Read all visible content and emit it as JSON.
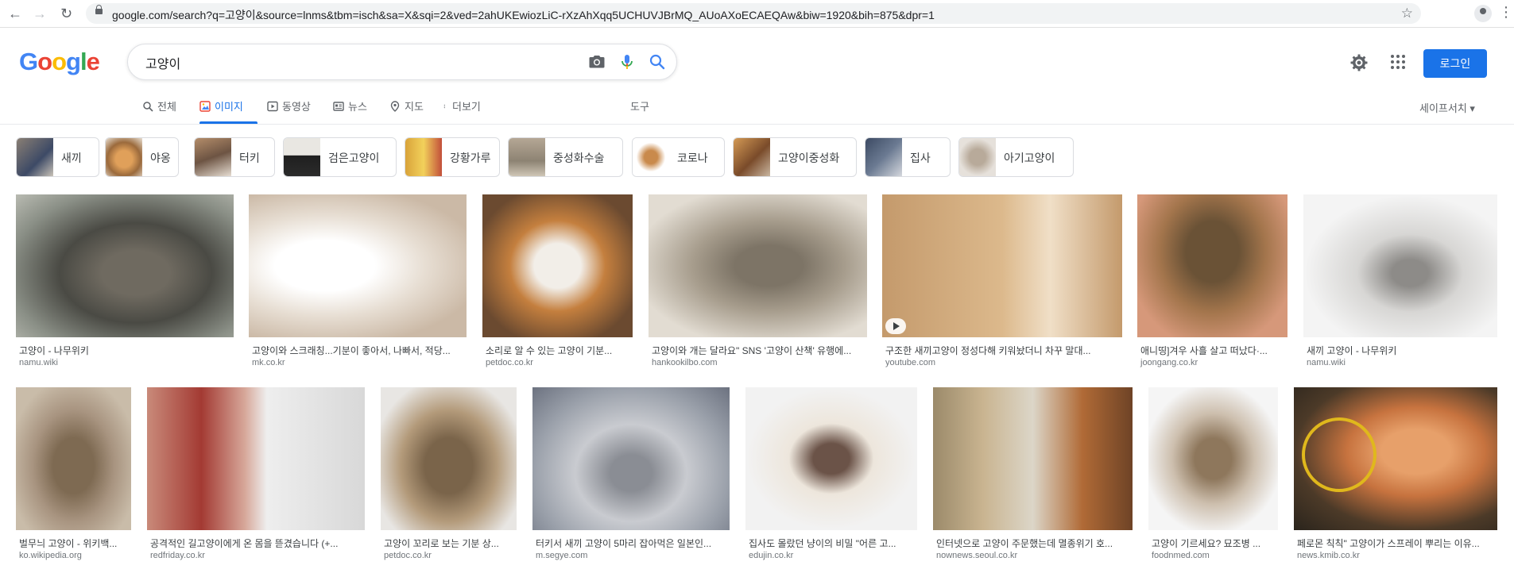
{
  "browser": {
    "back_icon": "←",
    "forward_icon": "→",
    "reload_icon": "↻",
    "url": "google.com/search?q=고양이&source=lnms&tbm=isch&sa=X&sqi=2&ved=2ahUKEwiozLiC-rXzAhXqq5UCHUVJBrMQ_AUoAXoECAEQAw&biw=1920&bih=875&dpr=1",
    "star_icon": "☆",
    "menu_icon": "⋮"
  },
  "logo": {
    "letters": [
      "G",
      "o",
      "o",
      "g",
      "l",
      "e"
    ]
  },
  "search": {
    "query": "고양이"
  },
  "header": {
    "login_label": "로그인"
  },
  "tabs": [
    {
      "label": "전체",
      "icon": "search-icon"
    },
    {
      "label": "이미지",
      "icon": "image-icon",
      "active": true
    },
    {
      "label": "동영상",
      "icon": "video-icon"
    },
    {
      "label": "뉴스",
      "icon": "news-icon"
    },
    {
      "label": "지도",
      "icon": "map-pin-icon"
    },
    {
      "label": "더보기",
      "icon": "more-icon"
    }
  ],
  "tools_label": "도구",
  "safesearch_label": "세이프서치 ▾",
  "chips": [
    {
      "label": "새끼"
    },
    {
      "label": "야옹"
    },
    {
      "label": "터키"
    },
    {
      "label": "검은고양이"
    },
    {
      "label": "강황가루"
    },
    {
      "label": "중성화수술"
    },
    {
      "label": "코로나"
    },
    {
      "label": "고양이중성화"
    },
    {
      "label": "집사"
    },
    {
      "label": "아기고양이"
    }
  ],
  "results_row1": [
    {
      "title": "고양이 - 나무위키",
      "source": "namu.wiki"
    },
    {
      "title": "고양이와 스크래칭...기분이 좋아서, 나빠서, 적당...",
      "source": "mk.co.kr"
    },
    {
      "title": "소리로 알 수 있는 고양이 기분...",
      "source": "petdoc.co.kr"
    },
    {
      "title": "고양이와 개는 달라요\" SNS '고양이 산책' 유행에...",
      "source": "hankookilbo.com"
    },
    {
      "title": "구조한 새끼고양이 정성다해 키워놨더니 차꾸 말대...",
      "source": "youtube.com"
    },
    {
      "title": "애니띵]겨우 사흘 살고 떠났다·...",
      "source": "joongang.co.kr"
    },
    {
      "title": "새끼 고양이 - 나무위키",
      "source": "namu.wiki"
    }
  ],
  "results_row2": [
    {
      "title": "벌무늬 고양이 - 위키백...",
      "source": "ko.wikipedia.org"
    },
    {
      "title": "공격적인 길고양이에게 온 몸을 뜯겼습니다 (+...",
      "source": "redfriday.co.kr"
    },
    {
      "title": "고양이 꼬리로 보는 기분 상...",
      "source": "petdoc.co.kr"
    },
    {
      "title": "터키서 새끼 고양이 5마리 잡아먹은 일본인...",
      "source": "m.segye.com"
    },
    {
      "title": "집사도 몰랐던 냥이의 비밀 \"어른 고...",
      "source": "edujin.co.kr"
    },
    {
      "title": "인터넷으로 고양이 주문했는데 멸종위기 호...",
      "source": "nownews.seoul.co.kr"
    },
    {
      "title": "고양이 기르세요? 묘조병 ...",
      "source": "foodnmed.com"
    },
    {
      "title": "페로몬 칙칙\" 고양이가 스프레이 뿌리는 이유...",
      "source": "news.kmib.co.kr"
    }
  ]
}
